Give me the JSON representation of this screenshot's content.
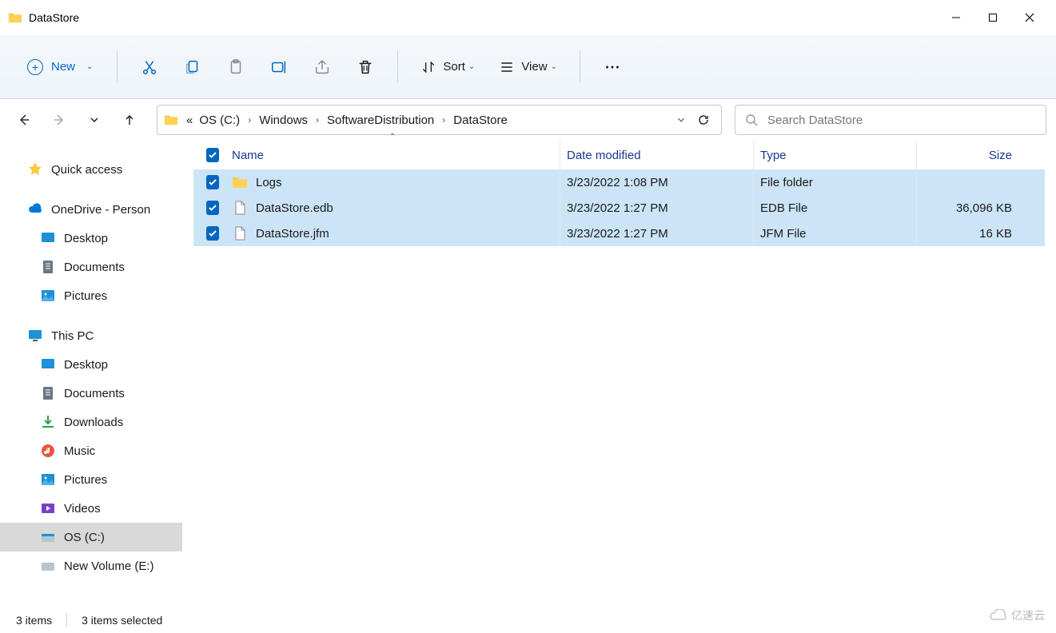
{
  "window": {
    "title": "DataStore"
  },
  "toolbar": {
    "new_label": "New",
    "sort_label": "Sort",
    "view_label": "View"
  },
  "breadcrumb": {
    "prefix": "«",
    "parts": [
      "OS (C:)",
      "Windows",
      "SoftwareDistribution",
      "DataStore"
    ]
  },
  "search": {
    "placeholder": "Search DataStore"
  },
  "columns": {
    "name": "Name",
    "date": "Date modified",
    "type": "Type",
    "size": "Size"
  },
  "files": [
    {
      "name": "Logs",
      "date": "3/23/2022 1:08 PM",
      "type": "File folder",
      "size": "",
      "icon": "folder"
    },
    {
      "name": "DataStore.edb",
      "date": "3/23/2022 1:27 PM",
      "type": "EDB File",
      "size": "36,096 KB",
      "icon": "file"
    },
    {
      "name": "DataStore.jfm",
      "date": "3/23/2022 1:27 PM",
      "type": "JFM File",
      "size": "16 KB",
      "icon": "file"
    }
  ],
  "sidebar": {
    "quick_access": "Quick access",
    "onedrive": "OneDrive - Person",
    "onedrive_items": [
      "Desktop",
      "Documents",
      "Pictures"
    ],
    "this_pc": "This PC",
    "this_pc_items": [
      "Desktop",
      "Documents",
      "Downloads",
      "Music",
      "Pictures",
      "Videos",
      "OS (C:)",
      "New Volume (E:)"
    ]
  },
  "status": {
    "count": "3 items",
    "selected": "3 items selected"
  },
  "watermark": "亿速云"
}
